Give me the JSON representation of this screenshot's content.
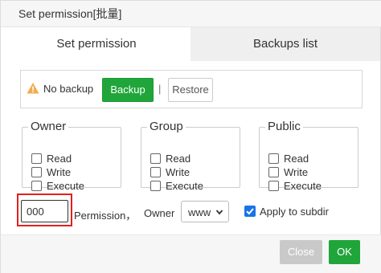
{
  "dialog": {
    "title": "Set permission[批量]"
  },
  "tabs": [
    {
      "label": "Set permission",
      "active": true
    },
    {
      "label": "Backups list",
      "active": false
    }
  ],
  "backup": {
    "status_text": "No backup",
    "status_icon": "warning-icon",
    "warning_color": "#f0ad4e",
    "backup_label": "Backup",
    "separator": "|",
    "restore_label": "Restore"
  },
  "groups": [
    {
      "legend": "Owner",
      "options": [
        {
          "label": "Read",
          "checked": false
        },
        {
          "label": "Write",
          "checked": false
        },
        {
          "label": "Execute",
          "checked": false
        }
      ]
    },
    {
      "legend": "Group",
      "options": [
        {
          "label": "Read",
          "checked": false
        },
        {
          "label": "Write",
          "checked": false
        },
        {
          "label": "Execute",
          "checked": false
        }
      ]
    },
    {
      "legend": "Public",
      "options": [
        {
          "label": "Read",
          "checked": false
        },
        {
          "label": "Write",
          "checked": false
        },
        {
          "label": "Execute",
          "checked": false
        }
      ]
    }
  ],
  "permission": {
    "value": "000",
    "label": "Permission，"
  },
  "owner": {
    "label": "Owner",
    "selected": "www"
  },
  "subdir": {
    "label": "Apply to subdir",
    "checked": true
  },
  "footer": {
    "close_label": "Close",
    "ok_label": "OK"
  },
  "colors": {
    "accent_green": "#20a53a",
    "highlight_red": "#e02020",
    "checkbox_blue": "#1a73e8"
  }
}
